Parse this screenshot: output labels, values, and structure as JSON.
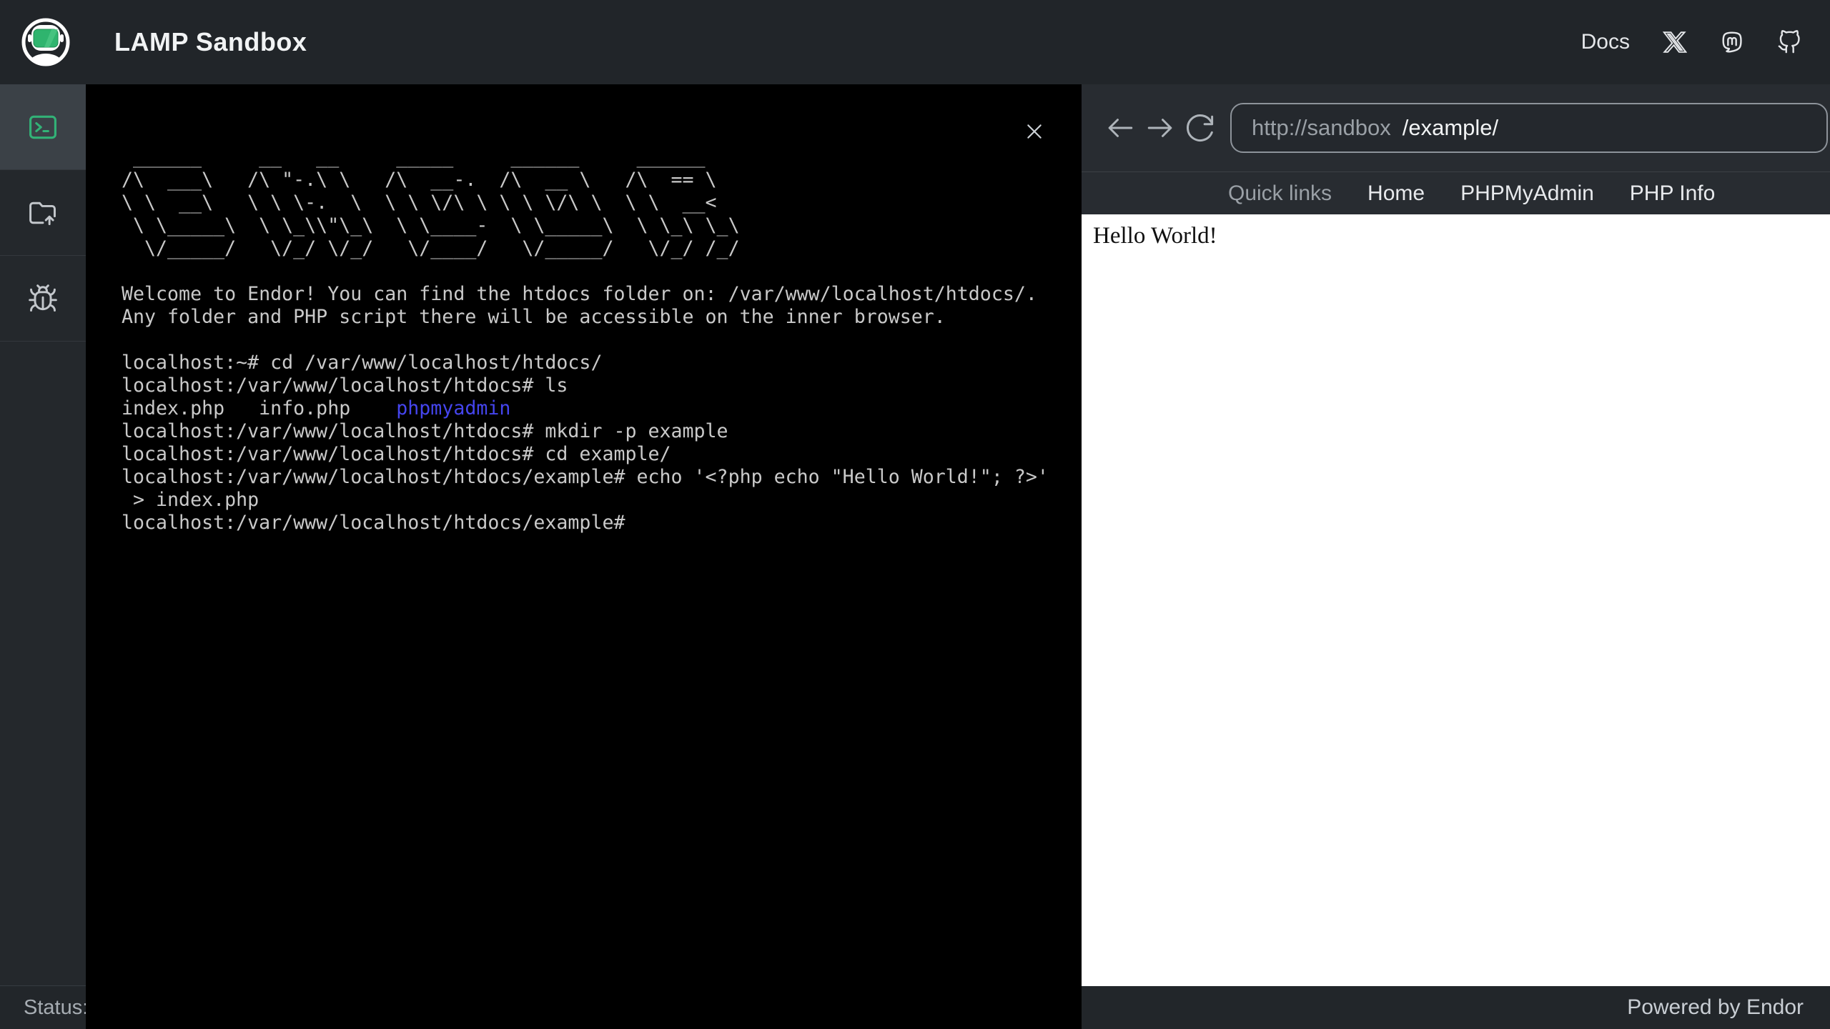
{
  "header": {
    "title": "LAMP Sandbox",
    "docs_label": "Docs",
    "icons": [
      "endor-astronaut-logo",
      "x-logo",
      "mastodon-logo",
      "github-logo"
    ]
  },
  "sidebar": {
    "items": [
      {
        "name": "terminal",
        "icon": "terminal-icon",
        "selected": true
      },
      {
        "name": "file-upload",
        "icon": "folder-upload-icon",
        "selected": false
      },
      {
        "name": "debug",
        "icon": "bug-icon",
        "selected": false
      }
    ]
  },
  "terminal": {
    "ascii_art": [
      " ______     __   __     _____     ______     ______    ",
      "/\\  ___\\   /\\ \"-.\\ \\   /\\  __-.  /\\  __ \\   /\\  == \\   ",
      "\\ \\  __\\   \\ \\ \\-.  \\  \\ \\ \\/\\ \\ \\ \\ \\/\\ \\  \\ \\  __<   ",
      " \\ \\_____\\  \\ \\_\\\\\"\\_\\  \\ \\____-  \\ \\_____\\  \\ \\_\\ \\_\\ ",
      "  \\/_____/   \\/_/ \\/_/   \\/____/   \\/_____/   \\/_/ /_/ "
    ],
    "welcome": [
      "Welcome to Endor! You can find the htdocs folder on: /var/www/localhost/htdocs/.",
      "Any folder and PHP script there will be accessible on the inner browser."
    ],
    "lines": [
      [
        {
          "t": "localhost:~# cd /var/www/localhost/htdocs/"
        }
      ],
      [
        {
          "t": "localhost:/var/www/localhost/htdocs# ls"
        }
      ],
      [
        {
          "t": "index.php   info.php    "
        },
        {
          "t": "phpmyadmin",
          "c": "#4545ee"
        }
      ],
      [
        {
          "t": "localhost:/var/www/localhost/htdocs# mkdir -p example"
        }
      ],
      [
        {
          "t": "localhost:/var/www/localhost/htdocs# cd example/"
        }
      ],
      [
        {
          "t": "localhost:/var/www/localhost/htdocs/example# echo '<?php echo \"Hello World!\"; ?>'"
        }
      ],
      [
        {
          "t": " > index.php"
        }
      ],
      [
        {
          "t": "localhost:/var/www/localhost/htdocs/example#"
        }
      ]
    ]
  },
  "browser": {
    "nav": {
      "url_host": "http://sandbox",
      "url_path": "/example/"
    },
    "quicklinks": {
      "label": "Quick links",
      "links": [
        "Home",
        "PHPMyAdmin",
        "PHP Info"
      ]
    },
    "content": {
      "text": "Hello World!"
    }
  },
  "statusbar": {
    "left": "Status:",
    "right": "Powered by Endor"
  },
  "colors": {
    "accent_green": "#32b277",
    "terminal_dir_blue": "#4545ee",
    "header_bg": "#212529",
    "terminal_bg": "#000000"
  }
}
